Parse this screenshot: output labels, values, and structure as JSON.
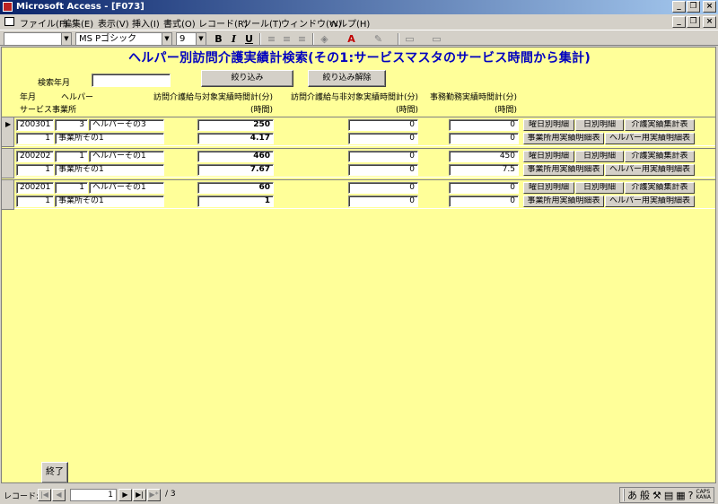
{
  "window": {
    "title": "Microsoft Access - [F073]"
  },
  "menu": {
    "items": [
      "ファイル(F)",
      "編集(E)",
      "表示(V)",
      "挿入(I)",
      "書式(O)",
      "レコード(R)",
      "ツール(T)",
      "ウィンドウ(W)",
      "ヘルプ(H)"
    ]
  },
  "toolbar": {
    "object_combo": "",
    "font_name": "MS Pゴシック",
    "font_size": "9",
    "bold": "B",
    "italic": "I",
    "underline": "U"
  },
  "form": {
    "title": "ヘルパー別訪問介護実績計検索(その1:サービスマスタのサービス時間から集計)",
    "search_label": "検索年月",
    "search_value": "",
    "filter_button": "絞り込み",
    "clear_filter_button": "絞り込み解除",
    "headers": {
      "year_month": "年月",
      "helper": "ヘルパー",
      "service_office": "サービス事業所",
      "visit_target": "訪問介護給与対象実績時間計(分)",
      "visit_target_hours": "(時間)",
      "visit_nontarget": "訪問介護給与非対象実績時間計(分)",
      "visit_nontarget_hours": "(時間)",
      "office_work": "事務勤務実績時間計(分)",
      "office_work_hours": "(時間)"
    },
    "row_buttons": {
      "weekday_detail": "曜日別明細",
      "daily_detail": "日別明細",
      "care_summary": "介護実績集計表",
      "office_detail": "事業所用実績明細表",
      "helper_detail": "ヘルパー用実績明細表"
    },
    "records": [
      {
        "year_month": "200301",
        "helper_no": "3",
        "helper_name": "ヘルパーその3",
        "office_no": "1",
        "office_name": "事業所その1",
        "target_min": "250",
        "target_hours": "4.17",
        "nontarget_min": "0",
        "nontarget_hours": "0",
        "office_min": "0",
        "office_hours": "0",
        "current": true
      },
      {
        "year_month": "200202",
        "helper_no": "1",
        "helper_name": "ヘルパーその1",
        "office_no": "1",
        "office_name": "事業所その1",
        "target_min": "460",
        "target_hours": "7.67",
        "nontarget_min": "0",
        "nontarget_hours": "0",
        "office_min": "450",
        "office_hours": "7.5",
        "current": false
      },
      {
        "year_month": "200201",
        "helper_no": "1",
        "helper_name": "ヘルパーその1",
        "office_no": "1",
        "office_name": "事業所その1",
        "target_min": "60",
        "target_hours": "1",
        "nontarget_min": "0",
        "nontarget_hours": "0",
        "office_min": "0",
        "office_hours": "0",
        "current": false
      }
    ],
    "close_button": "終了"
  },
  "navigation": {
    "label": "レコード:",
    "current": "1",
    "total": "/ 3"
  },
  "ime": {
    "mode": "あ",
    "kanji": "般",
    "caps": "CAPS",
    "kana": "KANA"
  }
}
